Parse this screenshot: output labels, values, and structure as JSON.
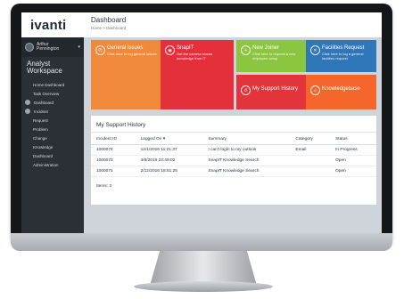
{
  "brand": {
    "logo_text": "ivanti"
  },
  "user": {
    "name_line1": "Arthur",
    "name_line2": "Pennington"
  },
  "workspace": {
    "line1": "Analyst",
    "line2": "Workspace"
  },
  "nav": {
    "items": [
      {
        "label": "Home Dashboard",
        "type": "sub"
      },
      {
        "label": "Task Overview",
        "type": "sub"
      },
      {
        "label": "Dashboard",
        "type": "icon"
      },
      {
        "label": "Incident",
        "type": "icon"
      },
      {
        "label": "Request",
        "type": "sub"
      },
      {
        "label": "Problem",
        "type": "sub"
      },
      {
        "label": "Change",
        "type": "sub"
      },
      {
        "label": "Knowledge",
        "type": "sub"
      },
      {
        "label": "Dashboard",
        "type": "sub"
      },
      {
        "label": "Administration",
        "type": "sub"
      }
    ]
  },
  "page": {
    "title": "Dashboard",
    "breadcrumb": "Home > Dashboard"
  },
  "tiles": [
    {
      "title": "General Issues",
      "desc": "Click here to log general issues",
      "icon": "phone-icon"
    },
    {
      "title": "SnapIT",
      "desc": "Get the camera shows knowledge from IT",
      "icon": "camera-icon"
    },
    {
      "title": "New Joiner",
      "desc": "Click here to request a new employee setup",
      "icon": "user-plus-icon"
    },
    {
      "title": "Facilities Request",
      "desc": "Click here to log a general facilities request",
      "icon": "tools-icon"
    },
    {
      "title": "My Support History",
      "desc": "",
      "icon": "history-icon"
    },
    {
      "title": "Knowledgebase",
      "desc": "",
      "icon": "book-icon"
    }
  ],
  "support_history": {
    "title": "My Support History",
    "columns": [
      "Incident ID",
      "Logged On ▾",
      "Summary",
      "Category",
      "Status"
    ],
    "rows": [
      [
        "1000074",
        "12/1/2016 11:21:37",
        "I can't login to my outlook",
        "Email",
        "In Progress"
      ],
      [
        "1000072",
        "4/8/2016 23:49:02",
        "SnapIT Knowledge Search",
        "",
        "Open"
      ],
      [
        "1000071",
        "2/12/2016 18:51:26",
        "SnapIT Knowledge Search",
        "",
        "Open"
      ]
    ],
    "items_label": "Items: 3"
  }
}
